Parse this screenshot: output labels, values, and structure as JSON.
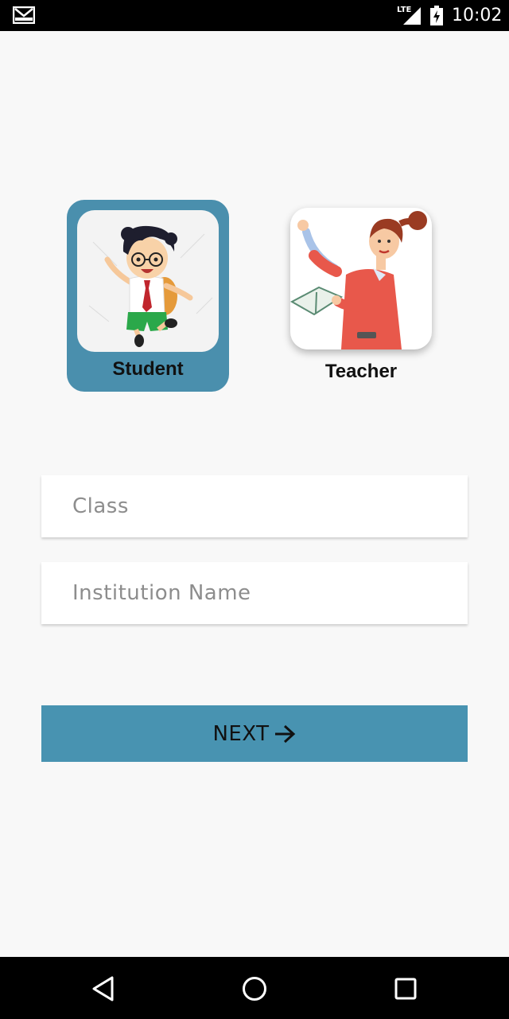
{
  "status_bar": {
    "network": "LTE",
    "time": "10:02",
    "icons": [
      "gmail-icon",
      "signal-icon",
      "battery-charging-icon"
    ]
  },
  "roles": [
    {
      "label": "Student",
      "selected": true,
      "icon": "student-illustration"
    },
    {
      "label": "Teacher",
      "selected": false,
      "icon": "teacher-illustration"
    }
  ],
  "form": {
    "class_placeholder": "Class",
    "class_value": "",
    "institution_placeholder": "Institution Name",
    "institution_value": ""
  },
  "next_button": {
    "label": "NEXT",
    "icon": "arrow-right-icon"
  },
  "nav_bar": {
    "icons": [
      "back-icon",
      "home-icon",
      "recents-icon"
    ]
  },
  "colors": {
    "accent": "#4893b1",
    "selected_card": "#4a8fad",
    "background": "#f8f8f8"
  }
}
